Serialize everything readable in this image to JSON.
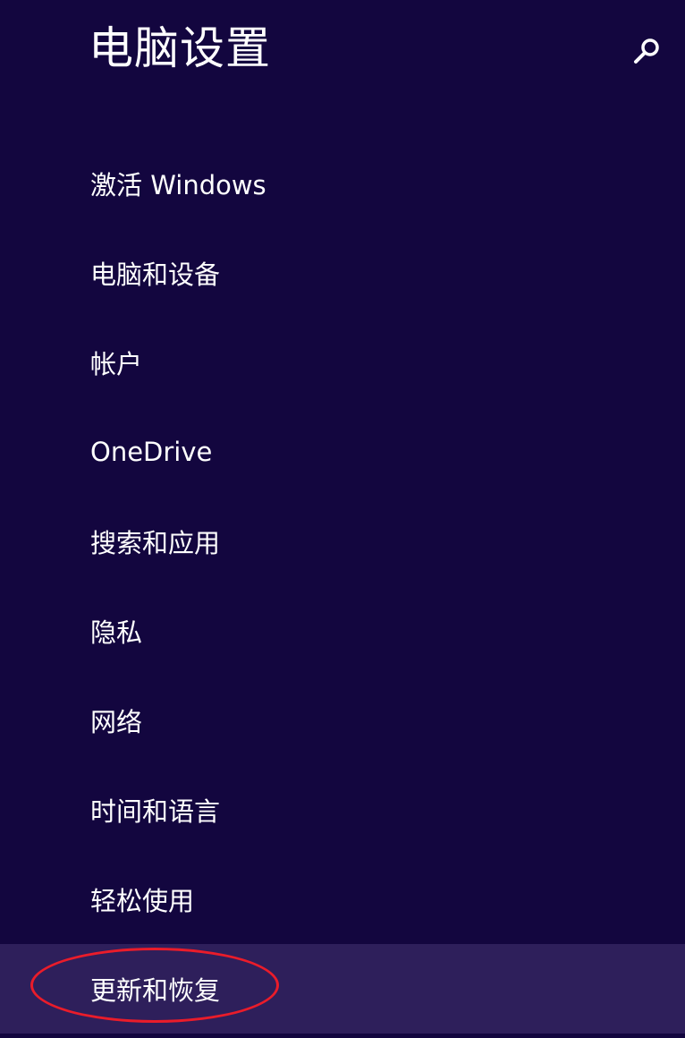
{
  "header": {
    "title": "电脑设置",
    "search_icon": "search-icon"
  },
  "nav": {
    "items": [
      {
        "label": "激活 Windows"
      },
      {
        "label": "电脑和设备"
      },
      {
        "label": "帐户"
      },
      {
        "label": "OneDrive"
      },
      {
        "label": "搜索和应用"
      },
      {
        "label": "隐私"
      },
      {
        "label": "网络"
      },
      {
        "label": "时间和语言"
      },
      {
        "label": "轻松使用"
      },
      {
        "label": "更新和恢复",
        "selected": true
      }
    ]
  },
  "annotation": {
    "highlight_color": "#ea1c2a",
    "target": "更新和恢复"
  },
  "colors": {
    "background": "#13063f",
    "selected_item": "#2e1f5b",
    "text": "#ffffff"
  }
}
